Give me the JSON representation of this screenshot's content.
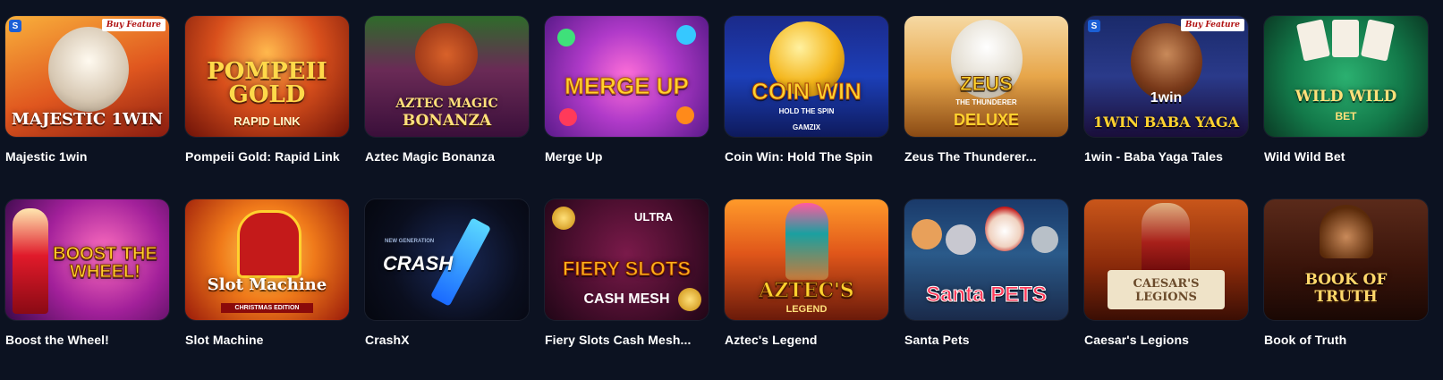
{
  "games_row1": [
    {
      "title": "Majestic 1win",
      "logo": "MAJESTIC 1WIN",
      "badge": "Buy Feature",
      "provider_badge": "S"
    },
    {
      "title": "Pompeii Gold: Rapid Link",
      "logo": "POMPEII GOLD",
      "sub": "RAPID LINK"
    },
    {
      "title": "Aztec Magic Bonanza",
      "logo": "AZTEC MAGIC",
      "sub": "BONANZA"
    },
    {
      "title": "Merge Up",
      "logo": "MERGE UP"
    },
    {
      "title": "Coin Win: Hold The Spin",
      "logo": "COIN WIN",
      "sub": "HOLD THE SPIN",
      "provider": "GAMZIX"
    },
    {
      "title": "Zeus The Thunderer...",
      "logo": "ZEUS",
      "sub": "THE THUNDERER",
      "sub2": "DELUXE"
    },
    {
      "title": "1win - Baba Yaga Tales",
      "logo": "1WIN BABA YAGA",
      "badge": "Buy Feature",
      "provider_badge": "S",
      "sub": "1win"
    },
    {
      "title": "Wild Wild Bet",
      "logo": "WILD WILD",
      "sub": "BET"
    }
  ],
  "games_row2": [
    {
      "title": "Boost the Wheel!",
      "logo": "BOOST THE WHEEL!"
    },
    {
      "title": "Slot Machine",
      "logo": "Slot Machine",
      "sub": "CHRISTMAS EDITION"
    },
    {
      "title": "CrashX",
      "logo": "CRASH",
      "sub": "NEW GENERATION"
    },
    {
      "title": "Fiery Slots Cash Mesh...",
      "logo": "FIERY SLOTS",
      "sub": "ULTRA",
      "sub2": "CASH MESH"
    },
    {
      "title": "Aztec's Legend",
      "logo": "AZTEC'S",
      "sub": "LEGEND"
    },
    {
      "title": "Santa Pets",
      "logo": "Santa PETS"
    },
    {
      "title": "Caesar's Legions",
      "logo": "CAESAR'S",
      "sub": "LEGIONS"
    },
    {
      "title": "Book of Truth",
      "logo": "BOOK OF",
      "sub": "TRUTH"
    }
  ],
  "colors": {
    "background": "#0c1221",
    "title_text": "#ffffff"
  }
}
